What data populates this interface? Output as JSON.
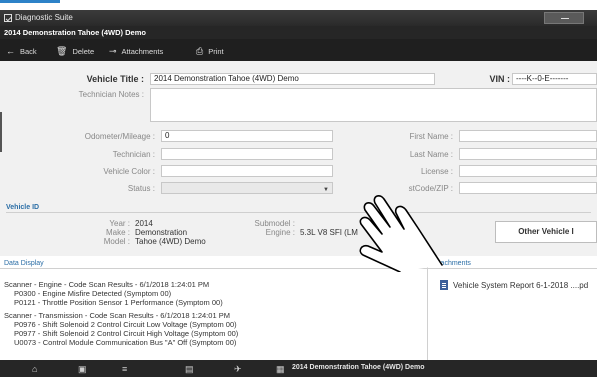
{
  "window": {
    "title": "Diagnostic Suite"
  },
  "document": {
    "title": "2014 Demonstration Tahoe (4WD) Demo"
  },
  "toolbar": {
    "back": {
      "label": "Back",
      "icon": "arrow-left-icon"
    },
    "delete": {
      "label": "Delete",
      "icon": "trash-icon"
    },
    "attachments": {
      "label": "Attachments",
      "icon": "paperclip-icon"
    },
    "print": {
      "label": "Print",
      "icon": "printer-icon"
    }
  },
  "form": {
    "vehicle_title_label": "Vehicle Title :",
    "vehicle_title_value": "2014 Demonstration Tahoe (4WD) Demo",
    "vin_label": "VIN :",
    "vin_value": "----K--0-E-------",
    "technician_notes_label": "Technician Notes :",
    "technician_notes_value": "",
    "odometer_label": "Odometer/Mileage :",
    "odometer_value": "0",
    "technician_label": "Technician :",
    "technician_value": "",
    "vehicle_color_label": "Vehicle Color :",
    "vehicle_color_value": "",
    "status_label": "Status :",
    "status_value": "",
    "first_name_label": "First Name :",
    "first_name_value": "",
    "last_name_label": "Last Name :",
    "last_name_value": "",
    "license_label": "License :",
    "license_value": "",
    "postcode_label": "stCode/ZIP :",
    "postcode_value": ""
  },
  "vehicle_id": {
    "section_label": "Vehicle ID",
    "year_label": "Year :",
    "year_value": "2014",
    "make_label": "Make :",
    "make_value": "Demonstration",
    "model_label": "Model :",
    "model_value": "Tahoe (4WD) Demo",
    "submodel_label": "Submodel :",
    "submodel_value": "",
    "engine_label": "Engine :",
    "engine_value": "5.3L V8 SFI (LM",
    "other_vehicle_button": "Other Vehicle I"
  },
  "data_display": {
    "section_label": "Data Display",
    "lines": [
      "Scanner - Engine - Code Scan Results - 6/1/2018 1:24:01 PM",
      "P0300 - Engine Misfire Detected (Symptom 00)",
      "P0121 - Throttle Position Sensor 1 Performance (Symptom 00)",
      "Scanner - Transmission - Code Scan Results - 6/1/2018 1:24:01 PM",
      "P0976 - Shift Solenoid 2 Control Circuit Low Voltage (Symptom 00)",
      "P0977 - Shift Solenoid 2 Control Circuit High Voltage (Symptom 00)",
      "U0073 - Control Module Communication Bus \"A\" Off (Symptom 00)"
    ]
  },
  "attachments": {
    "section_label": "Attachments",
    "items": [
      {
        "name": "Vehicle System Report 6-1-2018 ....pd",
        "icon": "document-icon"
      }
    ]
  },
  "statusbar": {
    "title": "2014 Demonstration Tahoe (4WD) Demo",
    "icons": [
      "home-icon",
      "scanner-icon",
      "tools-icon",
      "clipboard-icon",
      "plane-icon",
      "folder-icon"
    ]
  },
  "colors": {
    "accent": "#2b6ea6",
    "toolbar_bg": "#1f1f1f",
    "panel_bg": "#f1f1f1"
  }
}
